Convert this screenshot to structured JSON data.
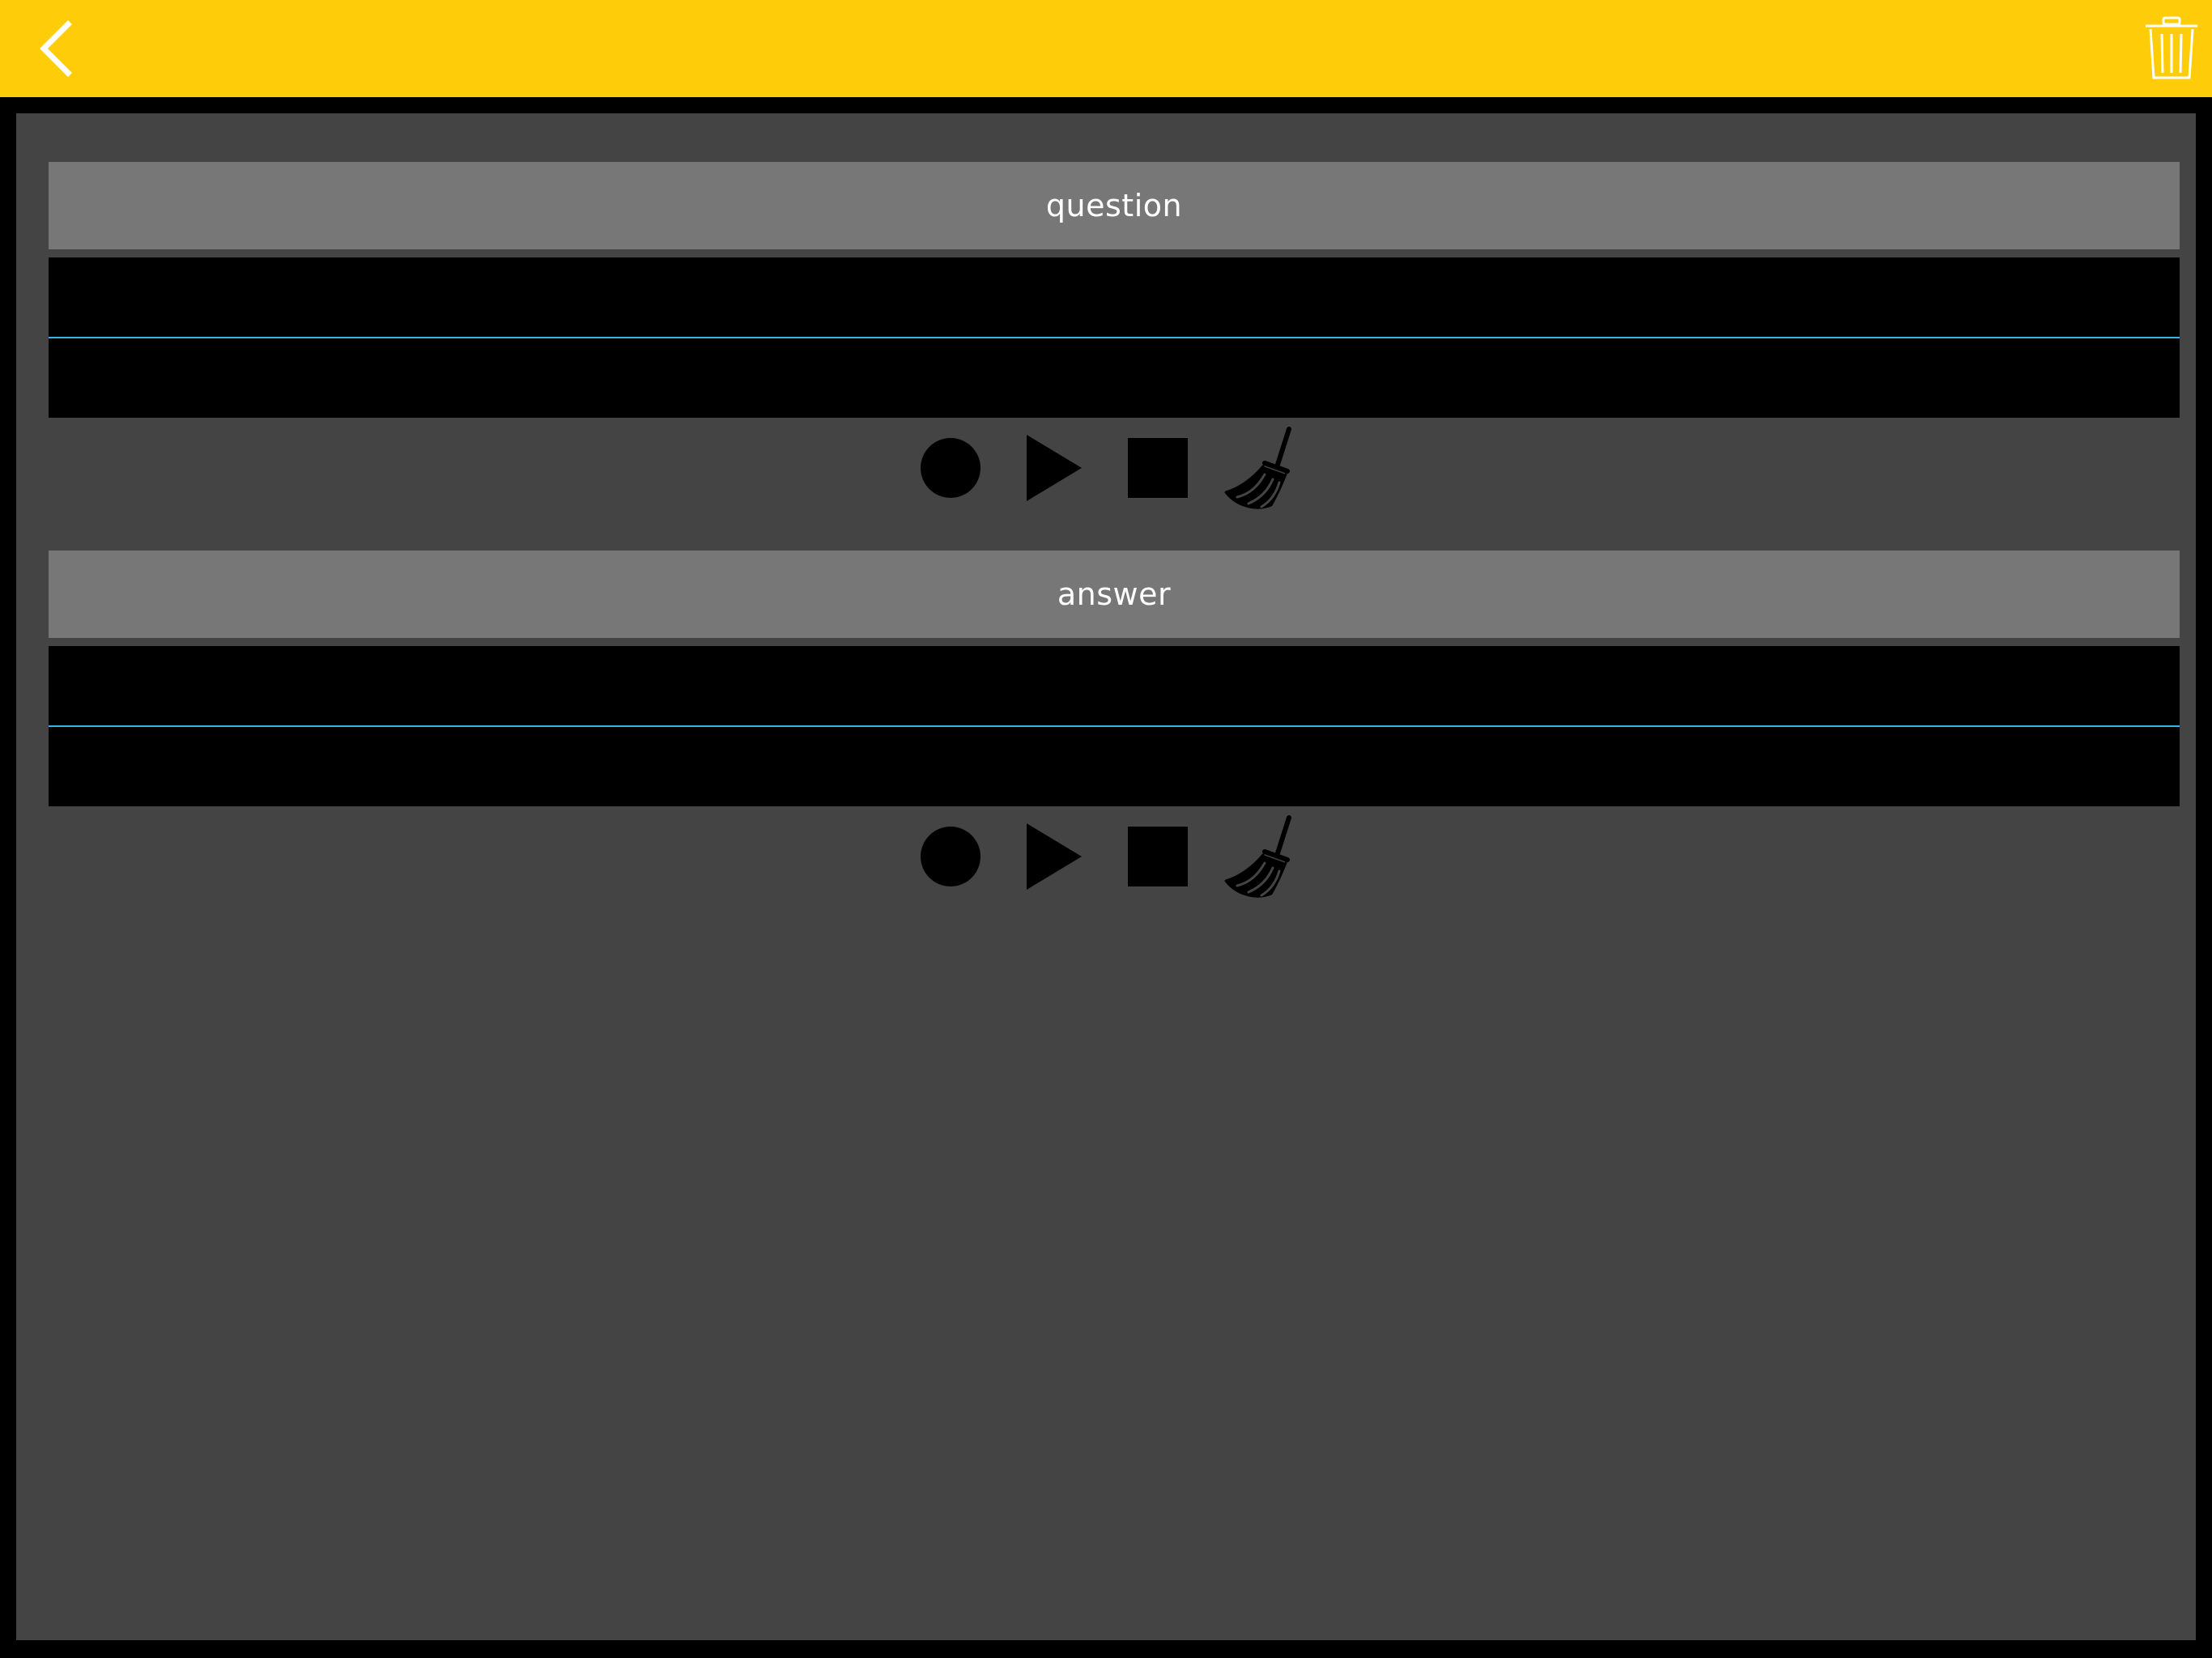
{
  "colors": {
    "topbar": "#FFCC0A",
    "panel": "#444444",
    "header": "#777777",
    "field": "#000000",
    "underline": "#33B5E5"
  },
  "toolbar": {
    "back_icon": "chevron-left-icon",
    "delete_icon": "trash-icon"
  },
  "question": {
    "label": "question",
    "line1_value": "",
    "line2_value": ""
  },
  "answer": {
    "label": "answer",
    "line1_value": "",
    "line2_value": ""
  },
  "controls": [
    "record-icon",
    "play-icon",
    "stop-icon",
    "broom-icon"
  ]
}
